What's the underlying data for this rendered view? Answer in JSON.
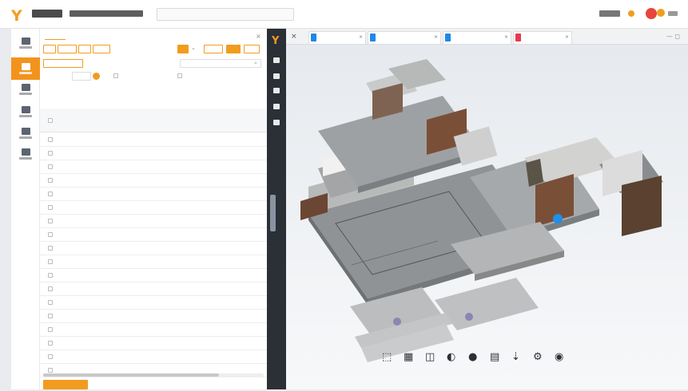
{
  "header": {
    "logo_glyph": "Y",
    "search_placeholder": "",
    "accent_color": "#f29c1f"
  },
  "left_nav": {
    "items": [
      {
        "icon": "grid-icon",
        "active": false
      },
      {
        "icon": "bim-icon",
        "active": true
      },
      {
        "icon": "list-icon",
        "active": false
      },
      {
        "icon": "chart-icon",
        "active": false
      },
      {
        "icon": "doc-icon",
        "active": false
      },
      {
        "icon": "user-icon",
        "active": false
      }
    ]
  },
  "panel": {
    "tabs": [
      "",
      ""
    ],
    "buttons": [
      "",
      "",
      "",
      ""
    ],
    "date_label": "",
    "badge": "",
    "right_buttons": [
      "",
      "",
      ""
    ],
    "search2_placeholder": "",
    "filter_label": "",
    "page_value": "",
    "check_options": [
      "",
      ""
    ],
    "columns": [
      "",
      "",
      "",
      "",
      "",
      ""
    ],
    "rows": [
      {
        "num": "",
        "code": "",
        "id": "",
        "name": "",
        "unit": "",
        "qty": ""
      },
      {
        "num": "",
        "code": "",
        "id": "",
        "name": "",
        "unit": "",
        "qty": ""
      },
      {
        "num": "",
        "code": "",
        "id": "",
        "name": "",
        "unit": "",
        "qty": ""
      },
      {
        "num": "",
        "code": "",
        "id": "",
        "name": "",
        "unit": "",
        "qty": ""
      },
      {
        "num": "",
        "code": "",
        "id": "",
        "name": "",
        "unit": "",
        "qty": ""
      },
      {
        "num": "",
        "code": "",
        "id": "",
        "name": "",
        "unit": "",
        "qty": ""
      },
      {
        "num": "",
        "code": "",
        "id": "",
        "name": "",
        "unit": "",
        "qty": ""
      },
      {
        "num": "",
        "code": "",
        "id": "",
        "name": "",
        "unit": "",
        "qty": ""
      },
      {
        "num": "",
        "code": "",
        "id": "",
        "name": "",
        "unit": "",
        "qty": ""
      },
      {
        "num": "",
        "code": "",
        "id": "",
        "name": "",
        "unit": "",
        "qty": ""
      },
      {
        "num": "",
        "code": "",
        "id": "",
        "name": "",
        "unit": "",
        "qty": ""
      },
      {
        "num": "",
        "code": "",
        "id": "",
        "name": "",
        "unit": "",
        "qty": ""
      },
      {
        "num": "",
        "code": "",
        "id": "",
        "name": "",
        "unit": "",
        "qty": ""
      },
      {
        "num": "",
        "code": "",
        "id": "",
        "name": "",
        "unit": "",
        "qty": ""
      },
      {
        "num": "",
        "code": "",
        "id": "",
        "name": "",
        "unit": "",
        "qty": ""
      },
      {
        "num": "",
        "code": "",
        "id": "",
        "name": "",
        "unit": "",
        "qty": ""
      },
      {
        "num": "",
        "code": "",
        "id": "",
        "name": "",
        "unit": "",
        "qty": ""
      },
      {
        "num": "",
        "code": "",
        "id": "",
        "name": "",
        "unit": "",
        "qty": ""
      },
      {
        "num": "",
        "code": "",
        "id": "",
        "name": "",
        "unit": "",
        "qty": ""
      }
    ],
    "bottom_buttons": [
      "",
      "",
      "",
      ""
    ]
  },
  "viewer": {
    "tabs": [
      {
        "label": "",
        "file_icon": "model-file-icon",
        "icon_color": "#1f88e5"
      },
      {
        "label": "",
        "file_icon": "model-file-icon",
        "icon_color": "#1f88e5"
      },
      {
        "label": "",
        "file_icon": "model-file-icon",
        "icon_color": "#1f88e5"
      },
      {
        "label": "",
        "file_icon": "pdf-file-icon",
        "icon_color": "#e53950"
      }
    ],
    "marker_color": "#1f8fe8",
    "tools": [
      {
        "icon": "home-view-icon",
        "glyph": "⬚"
      },
      {
        "icon": "section-box-icon",
        "glyph": "▦"
      },
      {
        "icon": "measure-icon",
        "glyph": "◫"
      },
      {
        "icon": "render-mode-icon",
        "glyph": "◐"
      },
      {
        "icon": "walk-icon",
        "glyph": "●"
      },
      {
        "icon": "properties-icon",
        "glyph": "▤"
      },
      {
        "icon": "pin-icon",
        "glyph": "⇣"
      },
      {
        "icon": "settings-icon",
        "glyph": "⚙"
      },
      {
        "icon": "fullscreen-icon",
        "glyph": "◉"
      }
    ]
  }
}
